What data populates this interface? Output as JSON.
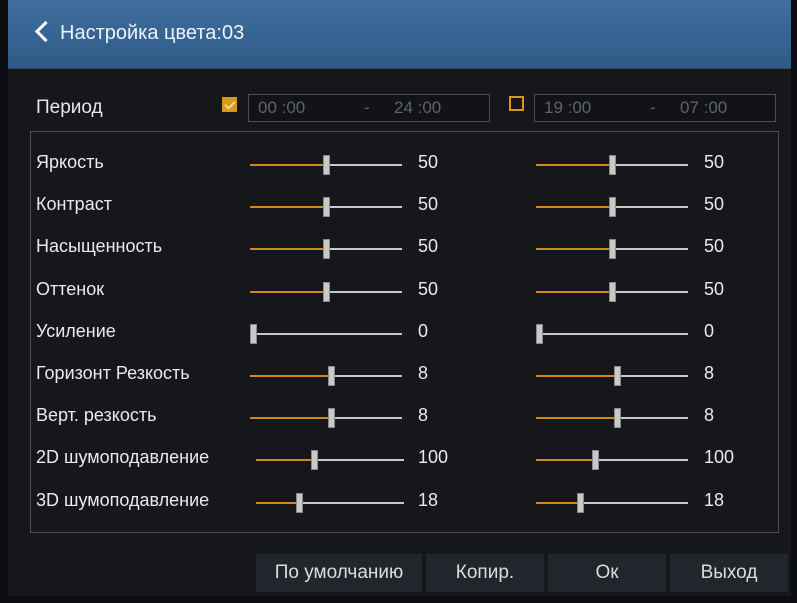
{
  "header": {
    "title": "Настройка цвета:03"
  },
  "period": {
    "label": "Период",
    "day": {
      "checked": true,
      "start": "00 :00",
      "sep": "-",
      "end": "24 :00"
    },
    "night": {
      "checked": false,
      "start": "19 :00",
      "sep": "-",
      "end": "07 :00"
    }
  },
  "settings": [
    {
      "label": "Яркость",
      "day": {
        "value": "50",
        "level": 0.5
      },
      "night": {
        "value": "50",
        "level": 0.5
      }
    },
    {
      "label": "Контраст",
      "day": {
        "value": "50",
        "level": 0.5
      },
      "night": {
        "value": "50",
        "level": 0.5
      }
    },
    {
      "label": "Насыщенность",
      "day": {
        "value": "50",
        "level": 0.5
      },
      "night": {
        "value": "50",
        "level": 0.5
      }
    },
    {
      "label": "Оттенок",
      "day": {
        "value": "50",
        "level": 0.5
      },
      "night": {
        "value": "50",
        "level": 0.5
      }
    },
    {
      "label": "Усиление",
      "day": {
        "value": "0",
        "level": 0
      },
      "night": {
        "value": "0",
        "level": 0
      }
    },
    {
      "label": "Горизонт Резкость",
      "day": {
        "value": "8",
        "level": 0.53
      },
      "night": {
        "value": "8",
        "level": 0.53
      }
    },
    {
      "label": "Верт. резкость",
      "day": {
        "value": "8",
        "level": 0.53
      },
      "night": {
        "value": "8",
        "level": 0.53
      }
    },
    {
      "label": "2D шумоподавление",
      "day": {
        "value": "100",
        "level": 0.39
      },
      "night": {
        "value": "100",
        "level": 0.39
      }
    },
    {
      "label": "3D шумоподавление",
      "day": {
        "value": "18",
        "level": 0.29
      },
      "night": {
        "value": "18",
        "level": 0.29
      }
    }
  ],
  "buttons": {
    "default": "По умолчанию",
    "copy": "Копир.",
    "ok": "Ок",
    "exit": "Выход"
  },
  "colors": {
    "accent": "#d08a1c",
    "title_bar": "#3a6896",
    "background": "#15171b"
  }
}
